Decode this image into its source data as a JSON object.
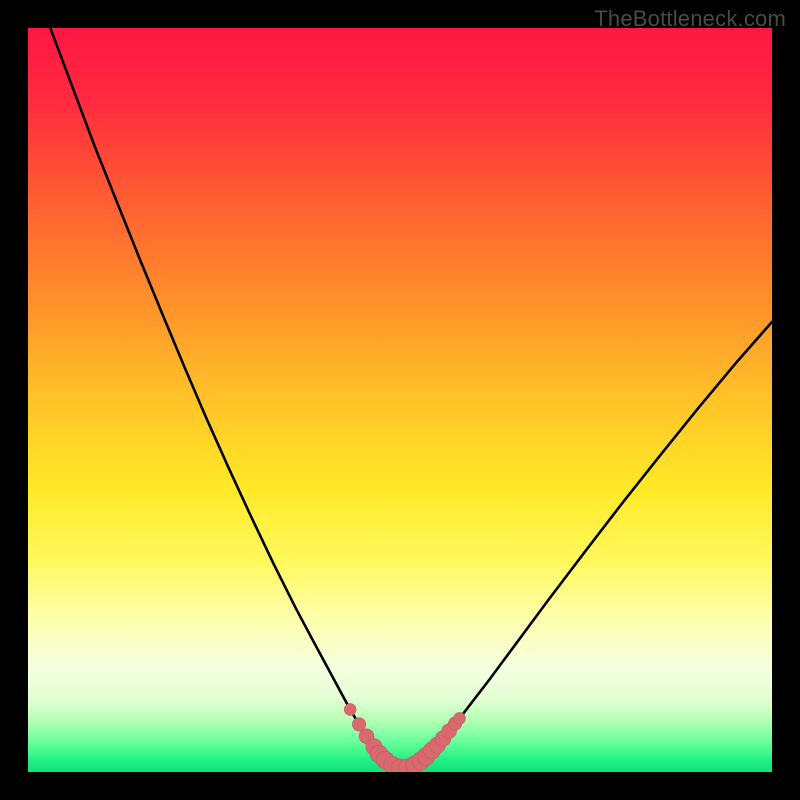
{
  "watermark": "TheBottleneck.com",
  "colors": {
    "frame": "#000000",
    "gradient_stops": [
      {
        "offset": 0.0,
        "color": "#ff1744"
      },
      {
        "offset": 0.1,
        "color": "#ff2b3f"
      },
      {
        "offset": 0.22,
        "color": "#ff5a33"
      },
      {
        "offset": 0.35,
        "color": "#ff8a2b"
      },
      {
        "offset": 0.5,
        "color": "#ffc328"
      },
      {
        "offset": 0.62,
        "color": "#ffe928"
      },
      {
        "offset": 0.72,
        "color": "#fff960"
      },
      {
        "offset": 0.8,
        "color": "#fdffb3"
      },
      {
        "offset": 0.86,
        "color": "#f5ffe0"
      },
      {
        "offset": 0.9,
        "color": "#e4ffd6"
      },
      {
        "offset": 0.93,
        "color": "#b6ffb6"
      },
      {
        "offset": 0.96,
        "color": "#66ff99"
      },
      {
        "offset": 0.985,
        "color": "#1fef84"
      },
      {
        "offset": 1.0,
        "color": "#12e07a"
      }
    ],
    "curve": "#000000",
    "marker_fill": "#d86a6f",
    "marker_stroke": "#c45a60"
  },
  "chart_data": {
    "type": "line",
    "title": "",
    "xlabel": "",
    "ylabel": "",
    "xlim": [
      0,
      100
    ],
    "ylim": [
      0,
      100
    ],
    "series": [
      {
        "name": "bottleneck-curve",
        "x": [
          0,
          3,
          6,
          9,
          12,
          15,
          18,
          21,
          24,
          27,
          30,
          33,
          36,
          38.5,
          40.5,
          42,
          43.3,
          44.5,
          45.5,
          46.5,
          47.2,
          48,
          49,
          50,
          51,
          52,
          53.2,
          55,
          58,
          62,
          66,
          70,
          75,
          80,
          85,
          90,
          95,
          100
        ],
        "y": [
          108,
          100,
          92,
          84,
          76.5,
          69,
          61.7,
          54.5,
          47.5,
          40.8,
          34.3,
          28,
          22,
          17.3,
          13.6,
          10.8,
          8.4,
          6.4,
          4.8,
          3.4,
          2.4,
          1.6,
          0.9,
          0.55,
          0.55,
          0.95,
          1.8,
          3.6,
          7.2,
          12.4,
          17.8,
          23.2,
          29.8,
          36.3,
          42.6,
          48.8,
          54.8,
          60.5
        ]
      }
    ],
    "markers": {
      "name": "bottom-band",
      "points": [
        {
          "x": 43.3,
          "y": 8.4,
          "r": 0.8
        },
        {
          "x": 44.5,
          "y": 6.4,
          "r": 0.9
        },
        {
          "x": 45.5,
          "y": 4.8,
          "r": 1.0
        },
        {
          "x": 46.5,
          "y": 3.4,
          "r": 1.1
        },
        {
          "x": 47.2,
          "y": 2.4,
          "r": 1.2
        },
        {
          "x": 48.0,
          "y": 1.6,
          "r": 1.2
        },
        {
          "x": 49.0,
          "y": 0.9,
          "r": 1.2
        },
        {
          "x": 50.0,
          "y": 0.55,
          "r": 1.2
        },
        {
          "x": 51.0,
          "y": 0.55,
          "r": 1.2
        },
        {
          "x": 52.0,
          "y": 0.95,
          "r": 1.2
        },
        {
          "x": 52.8,
          "y": 1.5,
          "r": 1.2
        },
        {
          "x": 53.5,
          "y": 2.1,
          "r": 1.2
        },
        {
          "x": 54.3,
          "y": 2.9,
          "r": 1.15
        },
        {
          "x": 55.0,
          "y": 3.6,
          "r": 1.1
        },
        {
          "x": 55.8,
          "y": 4.5,
          "r": 1.05
        },
        {
          "x": 56.6,
          "y": 5.5,
          "r": 1.0
        },
        {
          "x": 57.4,
          "y": 6.5,
          "r": 0.9
        },
        {
          "x": 58.0,
          "y": 7.2,
          "r": 0.8
        }
      ]
    }
  }
}
